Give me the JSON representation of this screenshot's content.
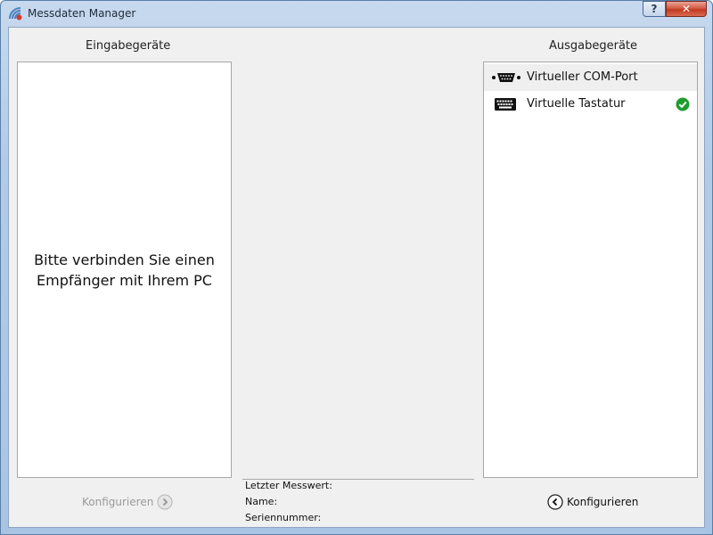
{
  "window": {
    "title": "Messdaten Manager",
    "help_label": "?",
    "close_label": "✕"
  },
  "input_devices": {
    "title": "Eingabegeräte",
    "empty_line1": "Bitte verbinden Sie einen",
    "empty_line2": "Empfänger mit Ihrem PC",
    "configure_label": "Konfigurieren"
  },
  "output_devices": {
    "title": "Ausgabegeräte",
    "items": [
      {
        "label": "Virtueller COM-Port",
        "icon": "serial-port-icon",
        "selected": true,
        "active": false
      },
      {
        "label": "Virtuelle Tastatur",
        "icon": "keyboard-icon",
        "selected": false,
        "active": true
      }
    ],
    "configure_label": "Konfigurieren"
  },
  "info": {
    "last_value_label": "Letzter Messwert:",
    "name_label": "Name:",
    "serial_label": "Seriennummer:"
  },
  "colors": {
    "active_check": "#1f9d2f",
    "disabled_text": "#9a9a9a"
  }
}
